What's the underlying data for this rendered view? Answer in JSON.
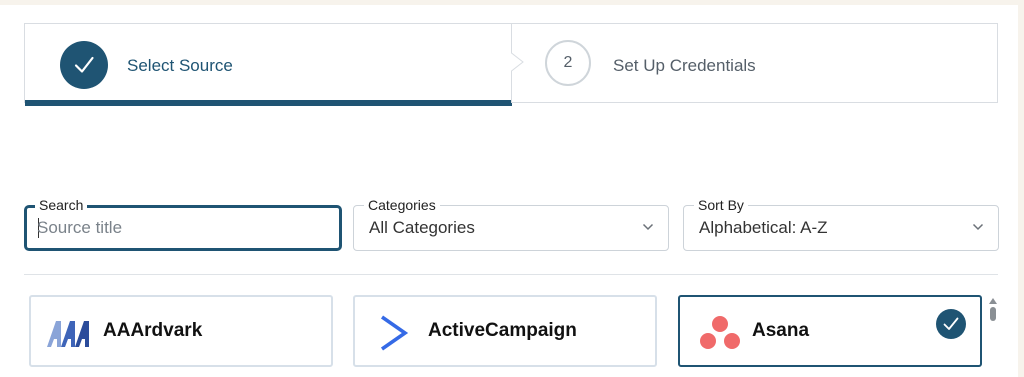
{
  "stepper": {
    "steps": [
      {
        "label": "Select Source",
        "state": "completed",
        "icon": "check-icon"
      },
      {
        "label": "Set Up Credentials",
        "number": "2",
        "state": "pending"
      }
    ]
  },
  "filters": {
    "search": {
      "label": "Search",
      "placeholder": "Source title",
      "value": ""
    },
    "categories": {
      "label": "Categories",
      "value": "All Categories"
    },
    "sort": {
      "label": "Sort By",
      "value": "Alphabetical: A-Z"
    }
  },
  "sources": [
    {
      "name": "AAArdvark",
      "icon": "aaardvark-logo",
      "selected": false
    },
    {
      "name": "ActiveCampaign",
      "icon": "activecampaign-logo",
      "selected": false
    },
    {
      "name": "Asana",
      "icon": "asana-logo",
      "selected": true
    }
  ],
  "colors": {
    "accent": "#1f5473",
    "asana": "#f06a6a",
    "activecampaign": "#356ae6",
    "aaardvark": "#2b4c9b"
  }
}
